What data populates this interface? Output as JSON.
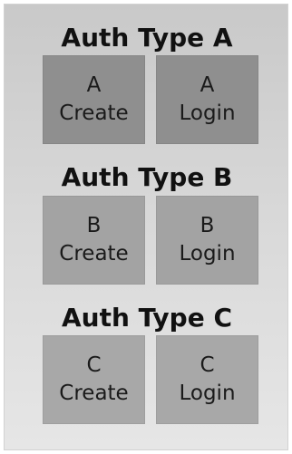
{
  "sections": [
    {
      "title": "Auth Type A",
      "create": {
        "letter": "A",
        "label": "Create"
      },
      "login": {
        "letter": "A",
        "label": "Login"
      }
    },
    {
      "title": "Auth Type B",
      "create": {
        "letter": "B",
        "label": "Create"
      },
      "login": {
        "letter": "B",
        "label": "Login"
      }
    },
    {
      "title": "Auth Type C",
      "create": {
        "letter": "C",
        "label": "Create"
      },
      "login": {
        "letter": "C",
        "label": "Login"
      }
    }
  ],
  "colors": {
    "panel_top": "#c9c9c9",
    "panel_bottom": "#e6e6e6",
    "tile_a": "#8f8f8f",
    "tile_b": "#a3a3a3",
    "tile_c": "#a8a8a8",
    "text": "#111111"
  }
}
